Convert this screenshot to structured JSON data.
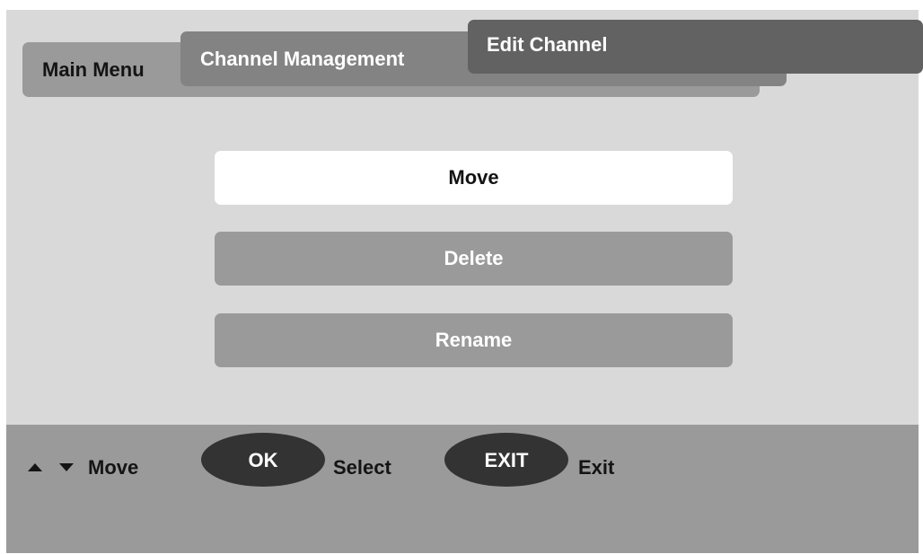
{
  "breadcrumb": {
    "main_menu": "Main Menu",
    "channel_management": "Channel Management",
    "edit_channel": "Edit Channel"
  },
  "menu": {
    "items": [
      {
        "label": "Move",
        "selected": true
      },
      {
        "label": "Delete",
        "selected": false
      },
      {
        "label": "Rename",
        "selected": false
      }
    ]
  },
  "footer": {
    "nav_icons": [
      "arrow-up-icon",
      "arrow-down-icon"
    ],
    "move_label": "Move",
    "ok_key": "OK",
    "select_label": "Select",
    "exit_key": "EXIT",
    "exit_label": "Exit"
  },
  "colors": {
    "screen_bg": "#d9d9d9",
    "selected_item_bg": "#ffffff",
    "item_bg": "#9a9a9a",
    "footer_bg": "#9a9a9a",
    "active_tab_bg": "#626262",
    "key_bg": "#333333"
  }
}
